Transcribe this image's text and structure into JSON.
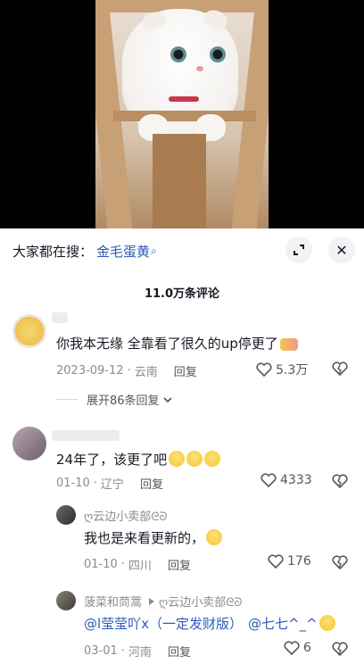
{
  "search_bar": {
    "prefix": "大家都在搜：",
    "term": "金毛蛋黄",
    "search_glyph": "⌕"
  },
  "header_buttons": {
    "collapse_icon": "collapse-icon",
    "close_glyph": "✕"
  },
  "comment_count_title": "11.0万条评论",
  "comments": [
    {
      "text": "你我本无缘 全靠看了很久的up停更了",
      "date": "2023-09-12",
      "location": "云南",
      "reply_label": "回复",
      "likes": "5.3万",
      "expand_label": "展开86条回复"
    },
    {
      "text": "24年了，该更了吧",
      "date": "01-10",
      "location": "辽宁",
      "reply_label": "回复",
      "likes": "4333"
    }
  ],
  "replies": [
    {
      "nick": "ღ云边小卖部ᘓᘐ",
      "text": "我也是来看更新的，",
      "date": "01-10",
      "location": "四川",
      "reply_label": "回复",
      "likes": "176"
    },
    {
      "nick": "菠菜和茼蒿",
      "reply_to": "ღ云边小卖部ᘓᘐ",
      "mention_1": "@l莹莹吖x（一定发财版）",
      "mention_2": "@七七^_^",
      "date": "03-01",
      "location": "河南",
      "reply_label": "回复",
      "likes": "6"
    }
  ],
  "colors": {
    "accent": "#2c5bb8",
    "text": "#161823",
    "secondary": "#8a8b91"
  }
}
